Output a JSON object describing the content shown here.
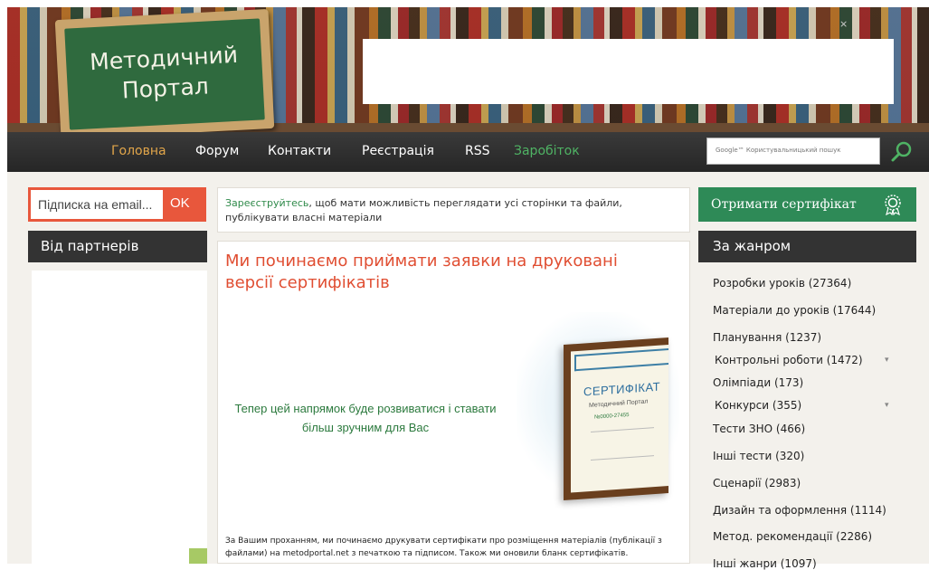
{
  "colors": {
    "accent_orange": "#e8573c",
    "nav_active": "#e2a64a",
    "nav_green": "#4fb364",
    "cert_green": "#2e8a57",
    "dark_header": "#333333",
    "title_red": "#e04e32"
  },
  "header": {
    "logo_line1": "Методичний",
    "logo_line2": "Портал"
  },
  "nav": {
    "items": [
      "Головна",
      "Форум",
      "Контакти",
      "Реєстрація",
      "RSS",
      "Заробіток"
    ],
    "search_placeholder": "Google™ Користувальницький пошук",
    "search_icon": "magnifier-icon"
  },
  "subscribe": {
    "placeholder": "Підписка на email...",
    "button": "OK"
  },
  "partners": {
    "title": "Від партнерів"
  },
  "notice": {
    "link": "Зареєструйтесь",
    "text": ", щоб мати можливість переглядати усі сторінки та файли, публікувати власні матеріали"
  },
  "article": {
    "title": "Ми починаємо приймати заявки на друковані версії сертифікатів",
    "highlight": "Тепер цей напрямок буде розвиватися і ставати більш зручним для Вас",
    "body": "За Вашим проханням, ми починаємо друкувати сертифікати про розміщення матеріалів (публікації з файлами) на metodportal.net з печаткою та підписом. Також ми оновили бланк сертифікатів.",
    "cert_title": "СЕРТИФІКАТ",
    "cert_sub": "Методичний Портал",
    "cert_num": "№0000-27455"
  },
  "sidebar": {
    "cert_button": "Отримати сертифікат",
    "cert_icon": "badge-icon",
    "genre_title": "За жанром",
    "genres": [
      "Розробки уроків (27364)",
      "Матеріали до уроків (17644)",
      "Планування (1237)",
      "Контрольні роботи (1472)",
      "Олімпіади (173)",
      "Конкурси (355)",
      "Тести ЗНО (466)",
      "Інші тести (320)",
      "Сценарії (2983)",
      "Дизайн та оформлення (1114)",
      "Метод. рекомендації (2286)",
      "Інші жанри (1097)"
    ]
  }
}
